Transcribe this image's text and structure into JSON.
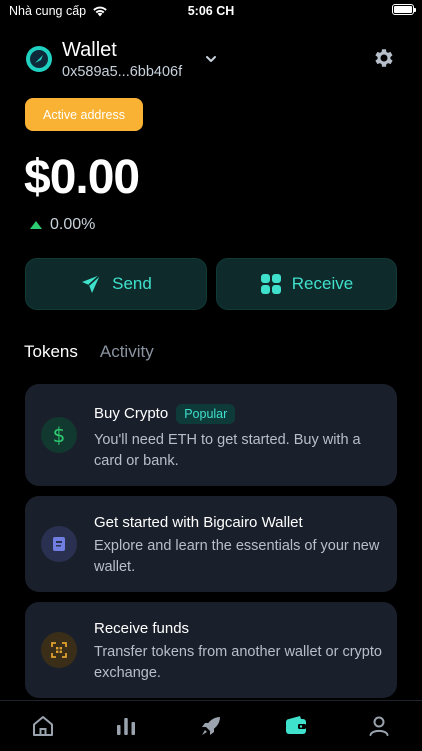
{
  "status_bar": {
    "carrier": "Nhà cung cấp",
    "time": "5:06 CH"
  },
  "wallet": {
    "name": "Wallet",
    "address": "0x589a5...6bb406f",
    "active_badge": "Active address"
  },
  "balance": {
    "amount": "$0.00",
    "change": "0.00%"
  },
  "actions": {
    "send": "Send",
    "receive": "Receive"
  },
  "tabs": {
    "tokens": "Tokens",
    "activity": "Activity"
  },
  "cards": [
    {
      "title": "Buy Crypto",
      "badge": "Popular",
      "description": "You'll need ETH to get started. Buy with a card or bank.",
      "icon": "dollar-icon"
    },
    {
      "title": "Get started with Bigcairo Wallet",
      "description": "Explore and learn the essentials of your new wallet.",
      "icon": "book-icon"
    },
    {
      "title": "Receive funds",
      "description": "Transfer tokens from another wallet or crypto exchange.",
      "icon": "qr-scan-icon"
    }
  ],
  "bottom_nav": [
    {
      "icon": "home-icon"
    },
    {
      "icon": "chart-icon"
    },
    {
      "icon": "rocket-icon"
    },
    {
      "icon": "wallet-icon",
      "active": true
    },
    {
      "icon": "profile-icon"
    }
  ],
  "colors": {
    "accent": "#3fe0cc",
    "badge": "#f9b233",
    "card": "#1a202b",
    "positive": "#2ecc71"
  }
}
